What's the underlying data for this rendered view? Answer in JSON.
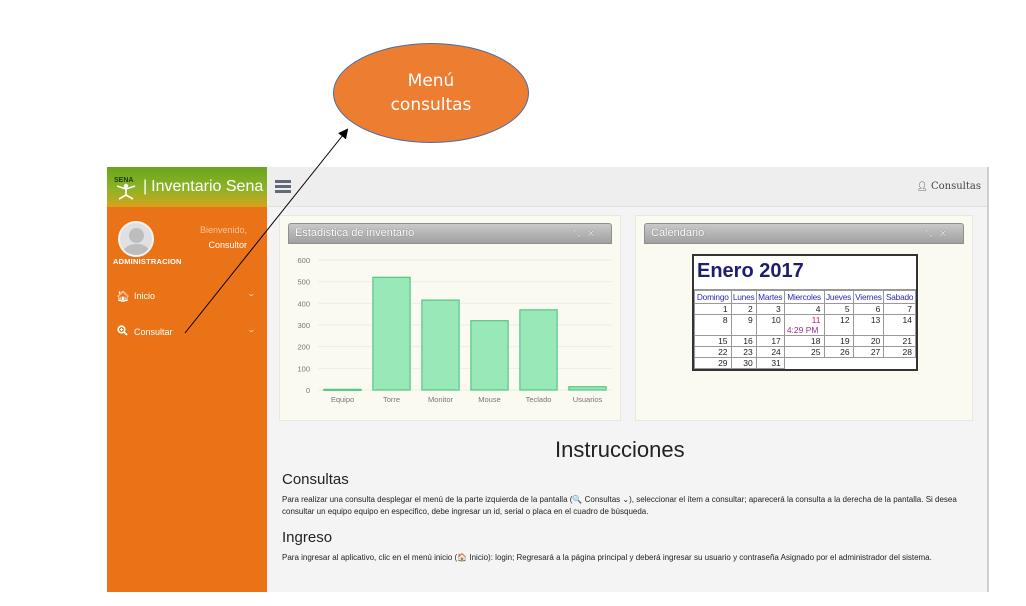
{
  "callout": {
    "line1": "Menú",
    "line2": "consultas"
  },
  "brand": {
    "title": "Inventario Sena",
    "logo_text": "SENA"
  },
  "profile": {
    "welcome": "Bienvenido,",
    "user": "Consultor",
    "role": "ADMINISTRACION"
  },
  "nav": [
    {
      "label": "Inicio",
      "icon": "home-icon"
    },
    {
      "label": "Consultar",
      "icon": "search-plus-icon"
    }
  ],
  "topbar": {
    "user_menu_label": "Consultas",
    "user_icon": "user-icon"
  },
  "stats_panel": {
    "title": "Estadistica de inventario",
    "tools": "⤡ ✕"
  },
  "calendar_panel": {
    "title": "Calendario",
    "tools": "⤡ ✕"
  },
  "chart_data": {
    "type": "bar",
    "categories": [
      "Equipo",
      "Torre",
      "Monitor",
      "Mouse",
      "Teclado",
      "Usuarios"
    ],
    "values": [
      3,
      520,
      415,
      320,
      370,
      15
    ],
    "ylim": [
      0,
      600
    ],
    "yticks": [
      0,
      100,
      200,
      300,
      400,
      500,
      600
    ],
    "bar_color": "#99e9b8",
    "bar_border": "#55c787",
    "grid": true
  },
  "calendar": {
    "title": "Enero 2017",
    "days": [
      "Domingo",
      "Lunes",
      "Martes",
      "Miercoles",
      "Jueves",
      "Viernes",
      "Sabado"
    ],
    "weeks": [
      [
        "1",
        "2",
        "3",
        "4",
        "5",
        "6",
        "7"
      ],
      [
        "8",
        "9",
        "10",
        "11",
        "12",
        "13",
        "14"
      ],
      [
        "15",
        "16",
        "17",
        "18",
        "19",
        "20",
        "21"
      ],
      [
        "22",
        "23",
        "24",
        "25",
        "26",
        "27",
        "28"
      ],
      [
        "29",
        "30",
        "31",
        "",
        "",
        "",
        ""
      ]
    ],
    "today": "11",
    "time": "4:29 PM"
  },
  "instructions": {
    "title": "Instrucciones",
    "consultas_heading": "Consultas",
    "consultas_text": "Para realizar una consulta desplegar el menú de la parte izquierda de la pantalla (🔍 Consultas ⌄), seleccionar el ítem a consultar; aparecerá la consulta a la derecha de la pantalla. Si desea consultar un equipo equipo en especifico, debe ingresar un id, serial o placa en el cuadro de búsqueda.",
    "ingreso_heading": "Ingreso",
    "ingreso_text": "Para ingresar al aplicativo, clic en el menú inicio (🏠 Inicio): login; Regresará a la página principal y deberá ingresar su usuario y contraseña Asignado por el administrador del sistema."
  },
  "colors": {
    "sidebar": "#ea7317",
    "callout": "#ed7d31",
    "accent_green": "#6aa51e"
  }
}
